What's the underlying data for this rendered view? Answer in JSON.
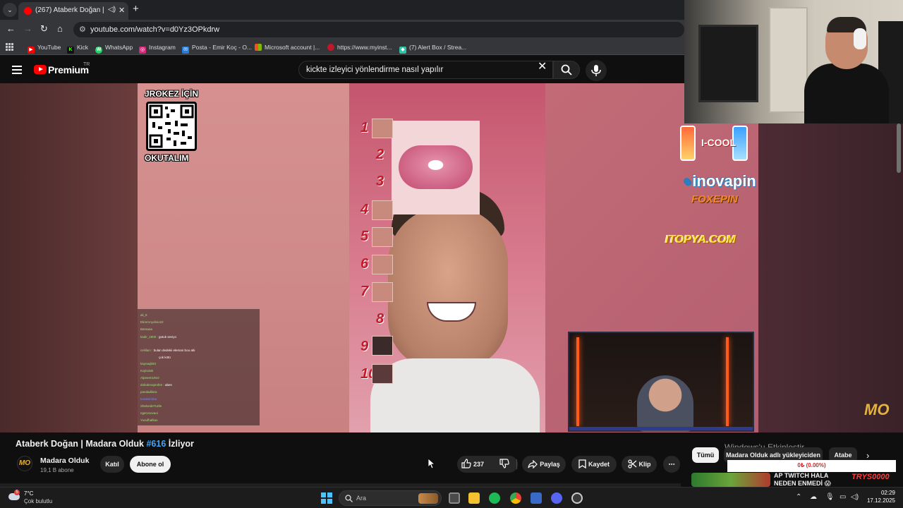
{
  "browser": {
    "tab_title": "(267) Ataberk Doğan | Mad",
    "url": "youtube.com/watch?v=d0Yz3OPkdrw",
    "bookmarks": [
      {
        "label": "YouTube",
        "color": "#ff0000",
        "glyph": "▶"
      },
      {
        "label": "Kick",
        "color": "#111111",
        "glyph": "K"
      },
      {
        "label": "WhatsApp",
        "color": "#25d366",
        "glyph": "W"
      },
      {
        "label": "Instagram",
        "color": "#d6297b",
        "glyph": "◎"
      },
      {
        "label": "Posta - Emir Koç - O...",
        "color": "#2a7ad8",
        "glyph": "✉"
      },
      {
        "label": "Microsoft account |...",
        "color": "#f25022",
        "glyph": "■"
      },
      {
        "label": "https://www.myinst...",
        "color": "#c0182a",
        "glyph": "●"
      },
      {
        "label": "(7) Alert Box / Strea...",
        "color": "#2ec4a8",
        "glyph": "◆"
      }
    ]
  },
  "youtube": {
    "brand": "Premium",
    "region": "TR",
    "search_query": "kickte izleyici yönlendirme nasıl yapılır"
  },
  "stream_overlay": {
    "qr_title": "JROKEZ İÇİN",
    "qr_subtitle": "OKUTALIM",
    "ranks": [
      "1",
      "2",
      "3",
      "4",
      "5",
      "6",
      "7",
      "8",
      "9",
      "10"
    ],
    "sponsor_cool": "I-COOL",
    "sponsor_inovapin": "inovapin",
    "sponsor_foxepin": "FOXEPIN",
    "sponsor_itopya": "ITOPYA.COM",
    "watermark": "MO",
    "chat": [
      {
        "user": "ali_8",
        "msg": ""
      },
      {
        "user": "EkremAydinio22",
        "msg": ""
      },
      {
        "user": "Baraaaa",
        "msg": ""
      },
      {
        "user": "kadir_1900",
        "msg": "gotuk seviyo"
      },
      {
        "user": "celiilarc",
        "msg": "bulan dedekii eleman bou abi"
      },
      {
        "user": "",
        "msg": "çok kötü"
      },
      {
        "user": "kaynaqb93",
        "msg": ""
      },
      {
        "user": "Kojiroiiek",
        "msg": ""
      },
      {
        "user": "Alpeeen1910",
        "msg": ""
      },
      {
        "user": "dobokmoprofen",
        "msg": "abes"
      },
      {
        "user": "pandadilara",
        "msg": ""
      },
      {
        "user": "tuvukenima",
        "msg": ""
      },
      {
        "user": "ShelvedeTurtle",
        "msg": ""
      },
      {
        "user": "ngeronovaoi",
        "msg": ""
      },
      {
        "user": "Yusufhafkas",
        "msg": ""
      }
    ]
  },
  "video": {
    "title_main": "Ataberk Doğan | Madara Olduk ",
    "title_hash": "#616",
    "title_tail": " İzliyor",
    "channel_name": "Madara Olduk",
    "channel_subs": "19,1 B abone",
    "avatar_text": "MO",
    "join_label": "Katıl",
    "subscribe_label": "Abone ol",
    "likes": "237",
    "share_label": "Paylaş",
    "save_label": "Kaydet",
    "clip_label": "Klip",
    "more_label": "⋯"
  },
  "sidebar": {
    "chips": [
      "Tümü",
      "Madara Olduk adlı yükleyiciden",
      "Atabe"
    ],
    "windows_activate": "Windows'u Etkinleştir",
    "windows_activate_sub": "Windows'u etkinleştirmek için Ayarlar'a gidin.",
    "popup_text": "0₺ (0.00%)",
    "rec_title_1": "AP TWITCH HALA",
    "rec_title_2": "NEDEN ENMEDİ 😱",
    "rec_logo": "TRYS0000"
  },
  "taskbar": {
    "temp": "7°C",
    "condition": "Çok bulutlu",
    "weather_badge": "5",
    "search_label": "Ara",
    "time": "02:29",
    "date": "17.12.2025"
  },
  "colors": {
    "accent_blue": "#3ea6ff",
    "youtube_red": "#ff0000",
    "popup_red": "#d12a2a"
  }
}
